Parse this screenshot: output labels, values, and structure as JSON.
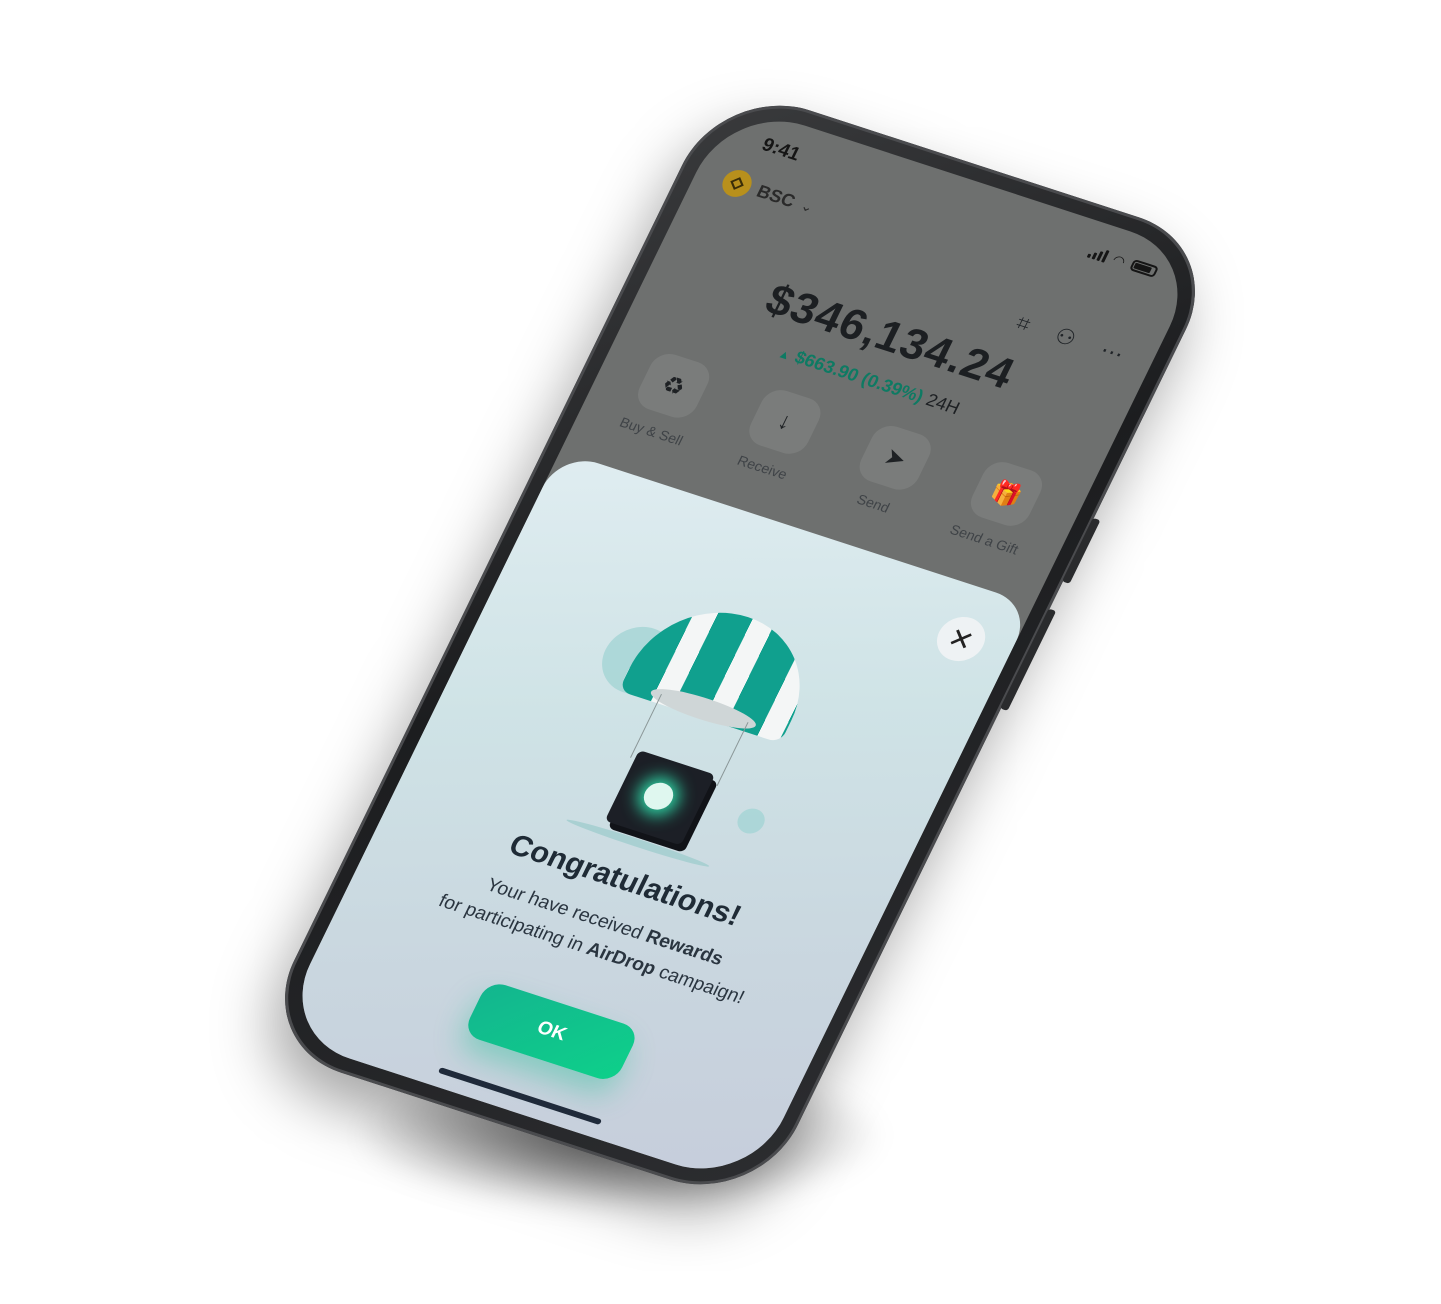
{
  "status_bar": {
    "time": "9:41"
  },
  "network": {
    "name": "BSC",
    "chevron": "⌄"
  },
  "top_icons": {
    "scan": "scan-icon",
    "contacts": "contacts-icon",
    "more": "more-icon"
  },
  "balance": {
    "total": "$346,134.24",
    "change_arrow": "▲",
    "change_value": "$663.90 (0.39%)",
    "change_period": "24H"
  },
  "actions": [
    {
      "label": "Buy & Sell",
      "glyph": "♻"
    },
    {
      "label": "Receive",
      "glyph": "↓"
    },
    {
      "label": "Send",
      "glyph": "➤"
    },
    {
      "label": "Send a Gift",
      "glyph": "🎁"
    }
  ],
  "modal": {
    "close_glyph": "✕",
    "title": "Congratulations!",
    "line1_prefix": "Your have received ",
    "line1_bold": "Rewards",
    "line2_prefix": "for participating in ",
    "line2_bold": "AirDrop",
    "line2_suffix": " campaign!",
    "ok_label": "OK"
  },
  "colors": {
    "accent": "#10a08e",
    "positive": "#0e7a63",
    "button": "#13b58f",
    "bnb": "#b8901c"
  }
}
